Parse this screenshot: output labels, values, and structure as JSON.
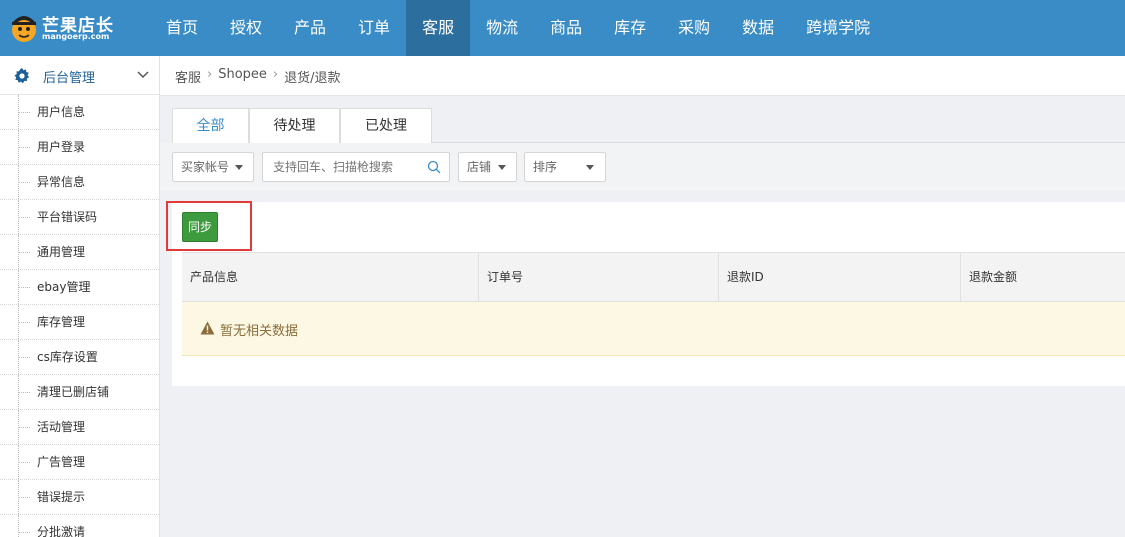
{
  "app": {
    "logo_cn": "芒果店长",
    "logo_en": "mangoerp.com"
  },
  "nav": {
    "items": [
      "首页",
      "授权",
      "产品",
      "订单",
      "客服",
      "物流",
      "商品",
      "库存",
      "采购",
      "数据",
      "跨境学院"
    ],
    "active_index": 4
  },
  "sidebar": {
    "title": "后台管理",
    "items": [
      "用户信息",
      "用户登录",
      "异常信息",
      "平台错误码",
      "通用管理",
      "ebay管理",
      "库存管理",
      "cs库存设置",
      "清理已删店铺",
      "活动管理",
      "广告管理",
      "错误提示",
      "分批激请"
    ]
  },
  "breadcrumb": [
    "客服",
    "Shopee",
    "退货/退款"
  ],
  "tabs": [
    "全部",
    "待处理",
    "已处理"
  ],
  "filters": {
    "buyer_account": "买家帐号",
    "search_placeholder": "支持回车、扫描枪搜索",
    "shop": "店铺",
    "sort": "排序"
  },
  "actions": {
    "sync_label": "同步"
  },
  "table": {
    "columns": [
      "产品信息",
      "订单号",
      "退款ID",
      "退款金额"
    ],
    "empty_text": "暂无相关数据"
  },
  "colors": {
    "nav_bg": "#3a8cc7",
    "nav_active": "#2c6e9e",
    "sync_button": "#3d9a3d",
    "highlight": "#e03a3a",
    "empty_bg": "#fcf8e3"
  }
}
